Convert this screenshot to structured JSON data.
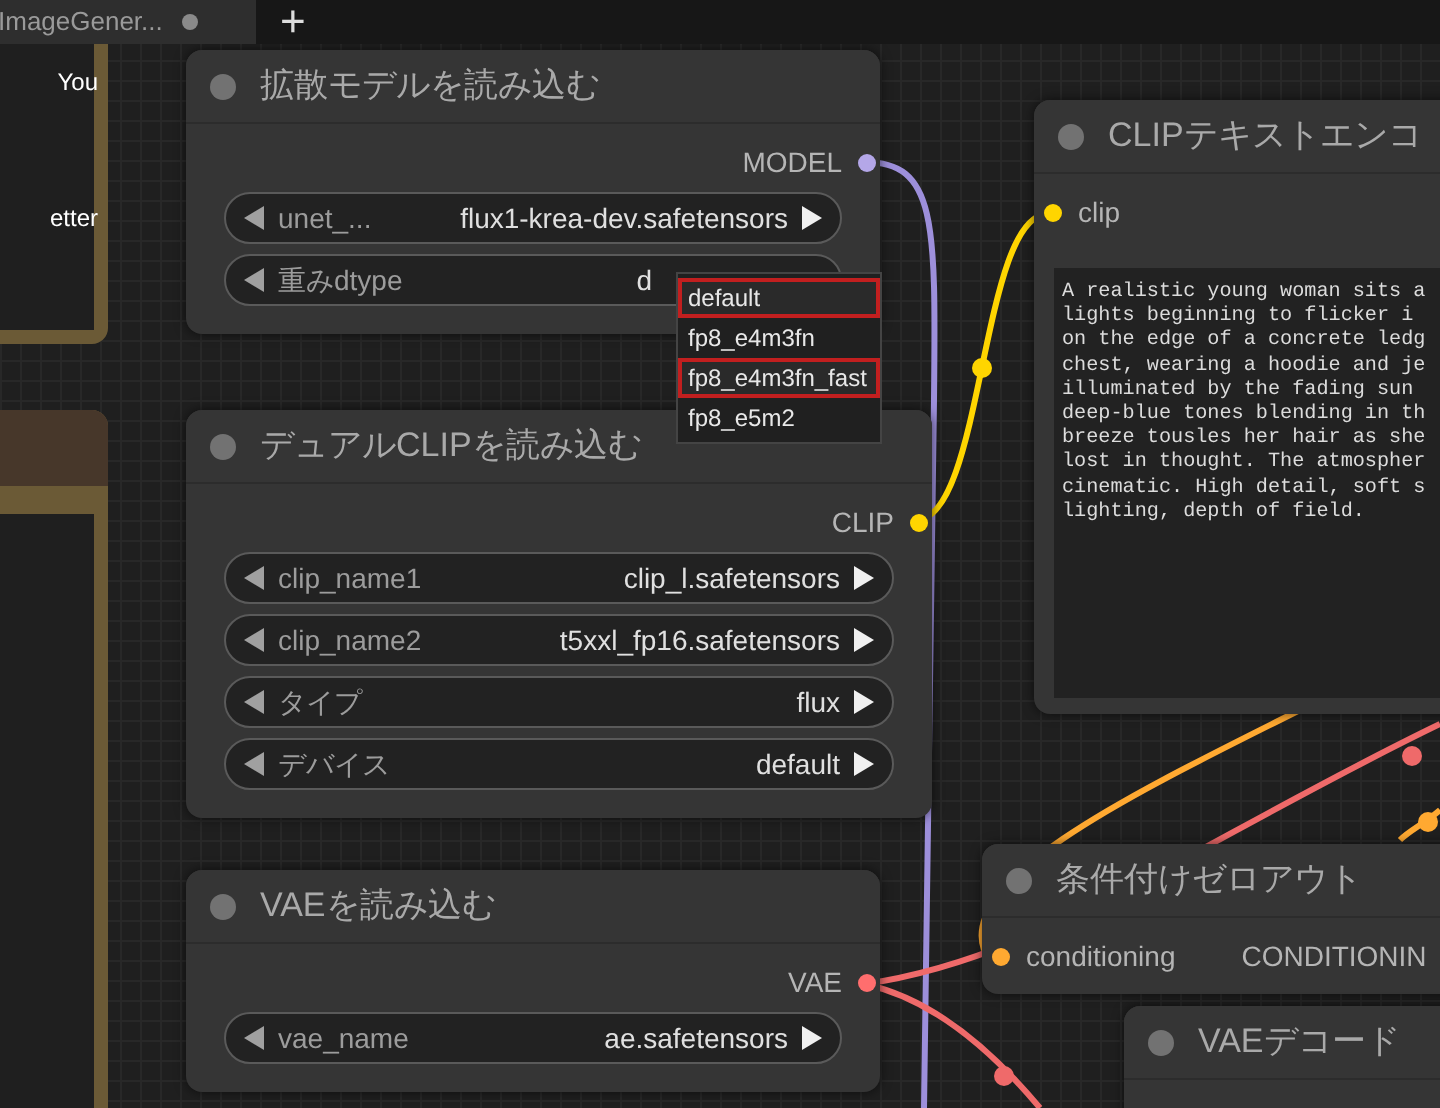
{
  "tab": {
    "title": "ImageGener...",
    "modified": true
  },
  "new_tab_button": "+",
  "note": {
    "texts": [
      "You",
      "etter"
    ]
  },
  "nodes": [
    {
      "title": "拡散モデルを読み込む",
      "outputs": [
        {
          "label": "MODEL",
          "color": "#b4a7e8"
        }
      ],
      "widgets": [
        {
          "label": "unet_...",
          "value": "flux1-krea-dev.safetensors"
        },
        {
          "label": "重みdtype",
          "value": "d",
          "dropdown": [
            {
              "label": "default",
              "highlighted": true
            },
            {
              "label": "fp8_e4m3fn",
              "highlighted": false
            },
            {
              "label": "fp8_e4m3fn_fast",
              "highlighted": true
            },
            {
              "label": "fp8_e5m2",
              "highlighted": false
            }
          ]
        }
      ]
    },
    {
      "title": "デュアルCLIPを読み込む",
      "outputs": [
        {
          "label": "CLIP",
          "color": "#ffd500"
        }
      ],
      "widgets": [
        {
          "label": "clip_name1",
          "value": "clip_l.safetensors"
        },
        {
          "label": "clip_name2",
          "value": "t5xxl_fp16.safetensors"
        },
        {
          "label": "タイプ",
          "value": "flux"
        },
        {
          "label": "デバイス",
          "value": "default"
        }
      ]
    },
    {
      "title": "VAEを読み込む",
      "outputs": [
        {
          "label": "VAE",
          "color": "#ff6e6e"
        }
      ],
      "widgets": [
        {
          "label": "vae_name",
          "value": "ae.safetensors"
        }
      ]
    },
    {
      "title": "CLIPテキストエンコ",
      "inputs": [
        {
          "label": "clip",
          "color": "#ffd500"
        }
      ],
      "text": [
        "A realistic young woman sits a",
        "lights beginning to flicker i",
        "on the edge of a concrete ledg",
        "chest, wearing a hoodie and je",
        "illuminated by the fading sun",
        "deep-blue tones blending in th",
        "breeze tousles her hair as she",
        "lost in thought. The atmospher",
        "cinematic. High detail, soft s",
        "lighting, depth of field."
      ]
    },
    {
      "title": "条件付けゼロアウト",
      "inputs": [
        {
          "label": "conditioning",
          "color": "#ffa931"
        }
      ],
      "outputs": [
        {
          "label": "CONDITIONIN"
        }
      ]
    },
    {
      "title": "VAEデコード"
    }
  ]
}
